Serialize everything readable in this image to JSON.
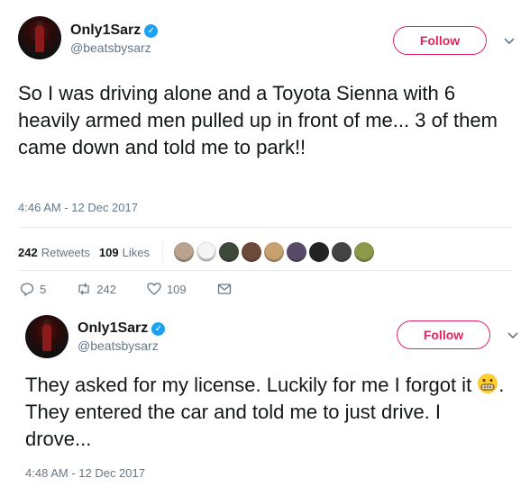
{
  "tweets": [
    {
      "display_name": "Only1Sarz",
      "handle": "@beatsbysarz",
      "follow_label": "Follow",
      "text": "So I was driving alone and a Toyota Sienna with 6 heavily armed men pulled up in front of me... 3 of them came down and told me to park!!",
      "timestamp": "4:46 AM - 12 Dec 2017",
      "retweets_count": "242",
      "retweets_label": "Retweets",
      "likes_count": "109",
      "likes_label": "Likes",
      "reply_count": "5",
      "retweet_action_count": "242",
      "like_action_count": "109",
      "likers": [
        {
          "icon": "avatar-photo",
          "color": "#b8a48c"
        },
        {
          "icon": "avatar-logo",
          "color": "#f5f5f5"
        },
        {
          "icon": "avatar-photo",
          "color": "#3d4a3a"
        },
        {
          "icon": "avatar-photo",
          "color": "#6b4a3a"
        },
        {
          "icon": "avatar-photo",
          "color": "#c8a070"
        },
        {
          "icon": "avatar-photo",
          "color": "#5a4a6a"
        },
        {
          "icon": "avatar-photo",
          "color": "#222222"
        },
        {
          "icon": "avatar-photo",
          "color": "#444444"
        },
        {
          "icon": "avatar-photo",
          "color": "#8a9a4a"
        }
      ]
    },
    {
      "display_name": "Only1Sarz",
      "handle": "@beatsbysarz",
      "follow_label": "Follow",
      "text_before_emoji": "They asked for my license. Luckily for me I forgot it ",
      "emoji": "grimacing-face",
      "text_after_emoji": ". They entered the car and told me to just drive. I drove...",
      "timestamp": "4:48 AM - 12 Dec 2017"
    }
  ],
  "colors": {
    "follow": "#e0245e",
    "verified": "#1da1f2",
    "meta": "#657786",
    "text": "#14171a"
  }
}
